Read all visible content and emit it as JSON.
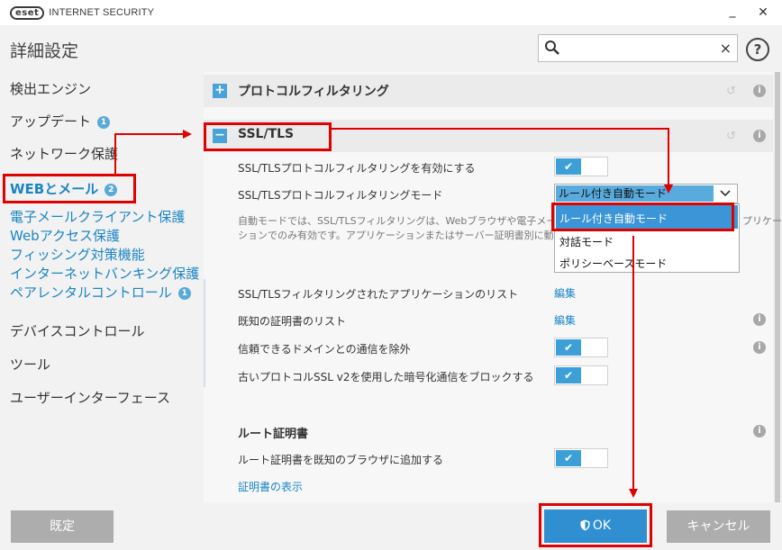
{
  "titlebar": {
    "logo_badge": "eset",
    "logo_text": "INTERNET SECURITY",
    "minimize": "_",
    "maximize": "□",
    "close": "✕"
  },
  "header": {
    "title": "詳細設定",
    "search_placeholder": "",
    "search_clear": "×",
    "help": "?"
  },
  "sidebar": {
    "items": [
      {
        "label": "検出エンジン"
      },
      {
        "label": "アップデート",
        "badge": "1"
      },
      {
        "label": "ネットワーク保護"
      },
      {
        "label": "WEBとメール",
        "badge": "2"
      },
      {
        "label": "デバイスコントロール"
      },
      {
        "label": "ツール"
      },
      {
        "label": "ユーザーインターフェース"
      }
    ],
    "sub_items": [
      {
        "label": "電子メールクライアント保護"
      },
      {
        "label": "Webアクセス保護"
      },
      {
        "label": "フィッシング対策機能"
      },
      {
        "label": "インターネットバンキング保護"
      },
      {
        "label": "ペアレンタルコントロール",
        "badge": "1"
      }
    ]
  },
  "content": {
    "sections": [
      {
        "toggle": "+",
        "title": "プロトコルフィルタリング"
      },
      {
        "toggle": "−",
        "title": "SSL/TLS"
      }
    ],
    "rows": {
      "enable_label": "SSL/TLSプロトコルフィルタリングを有効にする",
      "mode_label": "SSL/TLSプロトコルフィルタリングモード",
      "mode_value": "ルール付き自動モード",
      "mode_options": [
        "ルール付き自動モード",
        "対話モード",
        "ポリシーベースモード"
      ],
      "description_line1": "自動モードでは、SSL/TLSフィルタリングは、Webブラウザや電子メール",
      "description_line1_tail": "プリケー",
      "description_line2": "ションでのみ有効です。アプリケーションまたはサーバー証明書別に動作",
      "app_list_label": "SSL/TLSフィルタリングされたアプリケーションのリスト",
      "app_list_link": "編集",
      "cert_list_label": "既知の証明書のリスト",
      "cert_list_link": "編集",
      "exclude_trusted_label": "信頼できるドメインとの通信を除外",
      "block_ssl2_label": "古いプロトコルSSL v2を使用した暗号化通信をブロックする",
      "root_cert_title": "ルート証明書",
      "add_root_label": "ルート証明書を既知のブラウザに追加する",
      "show_cert_link": "証明書の表示"
    },
    "toggle_check": "✔",
    "info": "i",
    "revert": "↺"
  },
  "footer": {
    "default_label": "既定",
    "ok_label": "OK",
    "cancel_label": "キャンセル"
  },
  "colors": {
    "accent": "#3d9fd8",
    "link": "#1b85c4",
    "annotation": "#e00000"
  }
}
